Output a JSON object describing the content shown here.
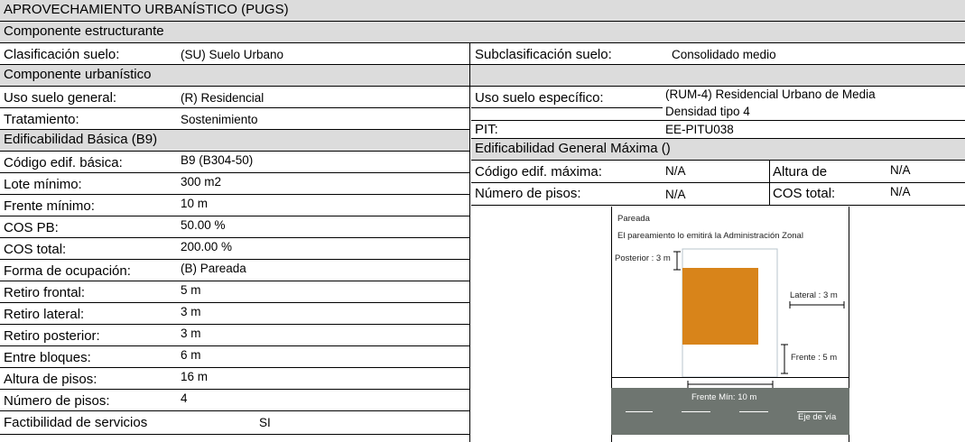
{
  "title": "APROVECHAMIENTO URBANÍSTICO (PUGS)",
  "estructurante": {
    "header": "Componente  estructurante",
    "clasificacion_label": "Clasificación suelo:",
    "clasificacion_value": "(SU) Suelo Urbano",
    "subclasificacion_label": "Subclasificación suelo:",
    "subclasificacion_value": "Consolidado medio"
  },
  "urbanistico": {
    "header": "Componente  urbanístico",
    "uso_general_label": "Uso suelo general:",
    "uso_general_value": "(R) Residencial",
    "uso_especifico_label": "Uso suelo específico:",
    "uso_especifico_value_line1": "(RUM-4) Residencial Urbano de Media",
    "uso_especifico_value_line2": "Densidad tipo 4",
    "tratamiento_label": "Tratamiento:",
    "tratamiento_value": "Sostenimiento",
    "pit_label": "PIT:",
    "pit_value": "EE-PITU038"
  },
  "basica": {
    "header": "Edificabilidad Básica (B9)",
    "rows": [
      {
        "label": "Código edif. básica:",
        "value": "B9 (B304-50)"
      },
      {
        "label": "Lote mínimo:",
        "value": "300 m2"
      },
      {
        "label": "Frente mínimo:",
        "value": "10 m"
      },
      {
        "label": "COS PB:",
        "value": "50.00 %"
      },
      {
        "label": "COS total:",
        "value": "200.00 %"
      },
      {
        "label": "Forma de ocupación:",
        "value": "(B) Pareada"
      },
      {
        "label": "Retiro frontal:",
        "value": "5 m"
      },
      {
        "label": "Retiro lateral:",
        "value": "3 m"
      },
      {
        "label": "Retiro posterior:",
        "value": "3 m"
      },
      {
        "label": "Entre bloques:",
        "value": "6 m"
      },
      {
        "label": "Altura de pisos:",
        "value": "16 m"
      },
      {
        "label": "Número de pisos:",
        "value": "4"
      }
    ],
    "factibilidad_label": "Factibilidad de servicios",
    "factibilidad_value": "SI"
  },
  "maxima": {
    "header": "Edificabilidad General Máxima ()",
    "codigo_label": "Código edif. máxima:",
    "codigo_value": "N/A",
    "altura_label": "Altura de",
    "altura_value": "N/A",
    "pisos_label": "Número de pisos:",
    "pisos_value": "N/A",
    "cos_label": "COS total:",
    "cos_value": "N/A"
  },
  "diagram": {
    "pareada": "Pareada",
    "pareamiento": "El pareamiento lo emitirá la Administración Zonal",
    "posterior": "Posterior : 3 m",
    "lateral": "Lateral : 3 m",
    "frente": "Frente : 5 m",
    "frente_min": "Frente Mín: 10 m",
    "eje_via": "Eje de vía",
    "colors": {
      "building": "#d8841a",
      "road": "#6e7570",
      "lot_border": "#b9c4cc"
    }
  }
}
